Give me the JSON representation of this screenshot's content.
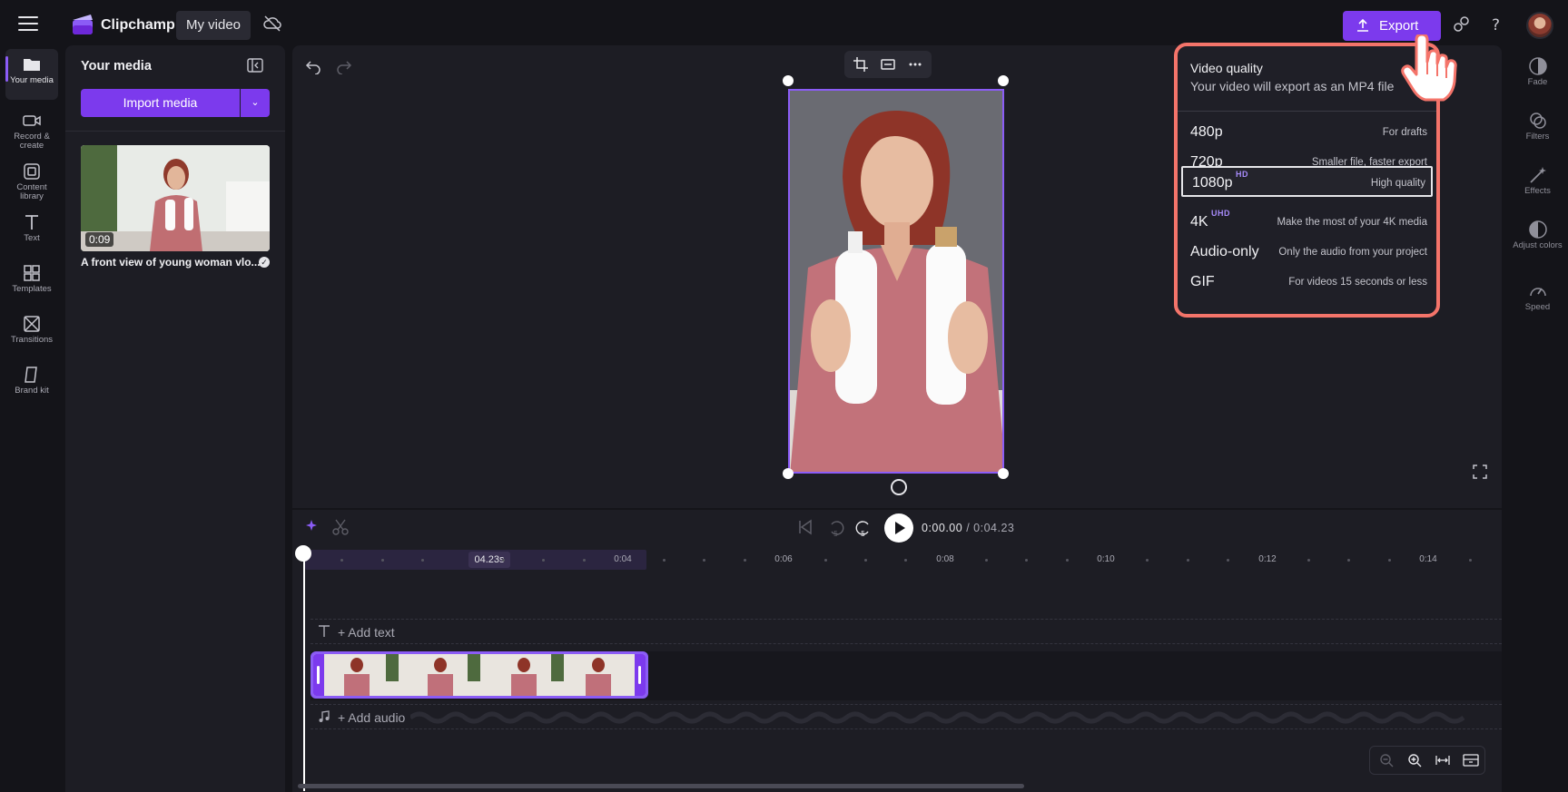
{
  "app": {
    "brand": "Clipchamp",
    "video_title": "My video",
    "export_label": "Export"
  },
  "rail": {
    "items": [
      {
        "label": "Your media",
        "icon": "folder-icon",
        "active": true
      },
      {
        "label": "Record & create",
        "icon": "camera-icon"
      },
      {
        "label": "Content library",
        "icon": "library-icon"
      },
      {
        "label": "Text",
        "icon": "text-icon"
      },
      {
        "label": "Templates",
        "icon": "templates-icon"
      },
      {
        "label": "Transitions",
        "icon": "transitions-icon"
      },
      {
        "label": "Brand kit",
        "icon": "brand-kit-icon"
      }
    ]
  },
  "media": {
    "title": "Your media",
    "import_label": "Import media",
    "item": {
      "duration": "0:09",
      "caption": "A front view of young woman vlo..."
    }
  },
  "right_rail": {
    "items": [
      {
        "label": "Fade",
        "icon": "fade-icon"
      },
      {
        "label": "Filters",
        "icon": "filters-icon"
      },
      {
        "label": "Effects",
        "icon": "effects-icon"
      },
      {
        "label": "Adjust colors",
        "icon": "adjust-colors-icon"
      },
      {
        "label": "Speed",
        "icon": "speed-icon"
      }
    ]
  },
  "export_menu": {
    "title": "Video quality",
    "subtitle": "Your video will export as an MP4 file",
    "options": [
      {
        "name": "480p",
        "badge": "",
        "desc": "For drafts",
        "selected": false
      },
      {
        "name": "720p",
        "badge": "",
        "desc": "Smaller file, faster export",
        "selected": false
      },
      {
        "name": "1080p",
        "badge": "HD",
        "desc": "High quality",
        "selected": true
      },
      {
        "name": "4K",
        "badge": "UHD",
        "desc": "Make the most of your 4K media",
        "selected": false
      },
      {
        "name": "Audio-only",
        "badge": "",
        "desc": "Only the audio from your project",
        "selected": false
      },
      {
        "name": "GIF",
        "badge": "",
        "desc": "For videos 15 seconds or less",
        "selected": false
      }
    ]
  },
  "timeline": {
    "current_time": "0:00.00",
    "total_time": "/ 0:04.23",
    "selection_length": "04.23s",
    "ruler_labels": [
      "0:04",
      "0:06",
      "0:08",
      "0:10",
      "0:12",
      "0:14"
    ],
    "add_text_label": "+ Add text",
    "add_audio_label": "+ Add audio"
  },
  "colors": {
    "accent": "#7c3aed",
    "highlight": "#f4746a",
    "panel": "#1d1d24",
    "background": "#141419"
  }
}
